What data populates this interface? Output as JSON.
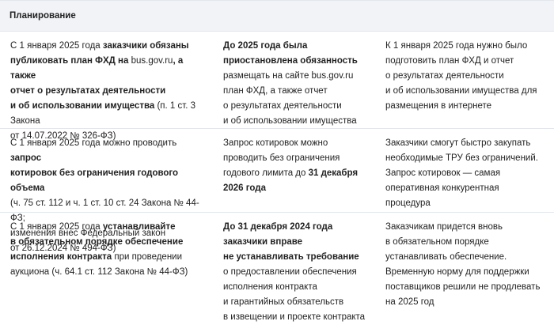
{
  "section_title": "Планирование",
  "rows": [
    {
      "col1": [
        {
          "t": "С 1 января 2025 года ",
          "b": false
        },
        {
          "t": "заказчики обязаны",
          "b": true
        },
        {
          "br": true
        },
        {
          "t": "публиковать план ФХД на ",
          "b": true
        },
        {
          "t": "bus.gov.ru",
          "b": false
        },
        {
          "t": ", а также",
          "b": true
        },
        {
          "br": true
        },
        {
          "t": "отчет о результатах деятельности",
          "b": true
        },
        {
          "br": true
        },
        {
          "t": "и об использовании имущества",
          "b": true
        },
        {
          "t": " (п. 1 ст. 3 Закона",
          "b": false
        },
        {
          "br": true
        },
        {
          "t": "от 14.07.2022 № 326-ФЗ)",
          "b": false
        }
      ],
      "col2": [
        {
          "t": "До 2025 года была",
          "b": true
        },
        {
          "br": true
        },
        {
          "t": "приостановлена обязанность",
          "b": true
        },
        {
          "br": true
        },
        {
          "t": "размещать на сайте bus.gov.ru",
          "b": false
        },
        {
          "br": true
        },
        {
          "t": "план ФХД, а также отчет",
          "b": false
        },
        {
          "br": true
        },
        {
          "t": "о результатах деятельности",
          "b": false
        },
        {
          "br": true
        },
        {
          "t": "и об использовании имущества",
          "b": false
        }
      ],
      "col3": [
        {
          "t": "К 1 января 2025 года нужно было",
          "b": false
        },
        {
          "br": true
        },
        {
          "t": "подготовить план ФХД и отчет",
          "b": false
        },
        {
          "br": true
        },
        {
          "t": "о результатах деятельности",
          "b": false
        },
        {
          "br": true
        },
        {
          "t": "и об использовании имущества для",
          "b": false
        },
        {
          "br": true
        },
        {
          "t": "размещения в интернете",
          "b": false
        }
      ]
    },
    {
      "col1": [
        {
          "t": "С 1 января 2025 года можно проводить ",
          "b": false
        },
        {
          "t": "запрос",
          "b": true
        },
        {
          "br": true
        },
        {
          "t": "котировок без ограничения годового объема",
          "b": true
        },
        {
          "br": true
        },
        {
          "t": "(ч. 75 ст. 112 и ч. 1 ст. 10 ст. 24 Закона № 44-ФЗ;",
          "b": false
        },
        {
          "br": true
        },
        {
          "t": "изменения внес Федеральный закон",
          "b": false
        },
        {
          "br": true
        },
        {
          "t": "от 26.12.2024 № 494-ФЗ)",
          "b": false
        }
      ],
      "col2": [
        {
          "t": "Запрос котировок можно",
          "b": false
        },
        {
          "br": true
        },
        {
          "t": "проводить без ограничения",
          "b": false
        },
        {
          "br": true
        },
        {
          "t": "годового лимита до ",
          "b": false
        },
        {
          "t": "31 декабря",
          "b": true
        },
        {
          "br": true
        },
        {
          "t": "2026 года",
          "b": true
        }
      ],
      "col3": [
        {
          "t": "Заказчики смогут быстро закупать",
          "b": false
        },
        {
          "br": true
        },
        {
          "t": "необходимые ТРУ без ограничений.",
          "b": false
        },
        {
          "br": true
        },
        {
          "t": "Запрос котировок — самая",
          "b": false
        },
        {
          "br": true
        },
        {
          "t": "оперативная конкурентная",
          "b": false
        },
        {
          "br": true
        },
        {
          "t": "процедура",
          "b": false
        }
      ]
    },
    {
      "col1": [
        {
          "t": "С 1 января 2025 года ",
          "b": false
        },
        {
          "t": "устанавливайте",
          "b": true
        },
        {
          "br": true
        },
        {
          "t": "в обязательном порядке обеспечение",
          "b": true
        },
        {
          "br": true
        },
        {
          "t": "исполнения контракта",
          "b": true
        },
        {
          "t": " при проведении",
          "b": false
        },
        {
          "br": true
        },
        {
          "t": "аукциона (ч. 64.1 ст. 112 Закона № 44-ФЗ)",
          "b": false
        }
      ],
      "col2": [
        {
          "t": "До 31 декабря 2024 года",
          "b": true
        },
        {
          "br": true
        },
        {
          "t": "заказчики вправе",
          "b": true
        },
        {
          "br": true
        },
        {
          "t": "не устанавливать требование",
          "b": true
        },
        {
          "br": true
        },
        {
          "t": "о предоставлении обеспечения",
          "b": false
        },
        {
          "br": true
        },
        {
          "t": "исполнения контракта",
          "b": false
        },
        {
          "br": true
        },
        {
          "t": "и гарантийных обязательств",
          "b": false
        },
        {
          "br": true
        },
        {
          "t": "в извещении и проекте контракта",
          "b": false
        }
      ],
      "col3": [
        {
          "t": "Заказчикам придется вновь",
          "b": false
        },
        {
          "br": true
        },
        {
          "t": "в обязательном порядке",
          "b": false
        },
        {
          "br": true
        },
        {
          "t": "устанавливать обеспечение.",
          "b": false
        },
        {
          "br": true
        },
        {
          "t": "Временную норму для поддержки",
          "b": false
        },
        {
          "br": true
        },
        {
          "t": "поставщиков решили не продлевать",
          "b": false
        },
        {
          "br": true
        },
        {
          "t": "на 2025 год",
          "b": false
        }
      ]
    }
  ]
}
